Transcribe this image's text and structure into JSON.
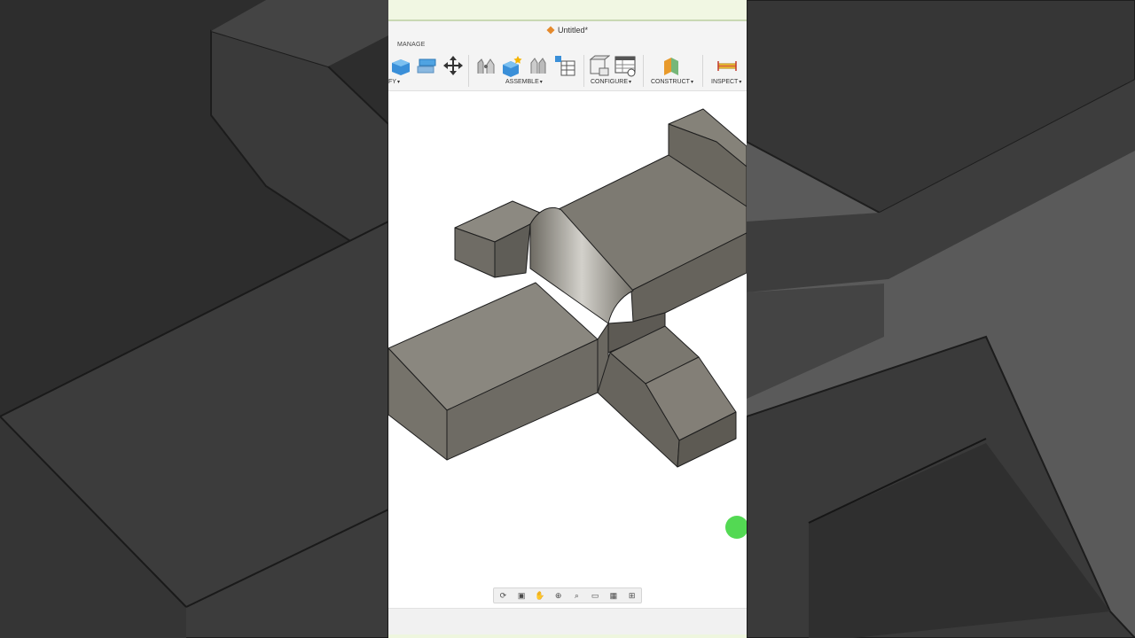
{
  "window": {
    "title": "Untitled*"
  },
  "toolbar": {
    "tab": "MANAGE",
    "groups": [
      {
        "label": "FY",
        "has_caret": true
      },
      {
        "label": "ASSEMBLE",
        "has_caret": true
      },
      {
        "label": "CONFIGURE",
        "has_caret": true
      },
      {
        "label": "CONSTRUCT",
        "has_caret": true
      },
      {
        "label": "INSPECT",
        "has_caret": true
      }
    ],
    "tools": [
      "shell-tool-icon",
      "combine-tool-icon",
      "move-tool-icon",
      "joint-icon",
      "new-component-icon",
      "as-built-joint-icon",
      "bill-of-materials-icon",
      "configure-cube-icon",
      "configure-table-icon",
      "construct-plane-icon",
      "measure-icon"
    ]
  },
  "viewport": {
    "model": "extruded-block-part",
    "body_color": "#7a776e"
  },
  "navigation": {
    "buttons": [
      "orbit-icon",
      "look-at-icon",
      "pan-icon",
      "zoom-icon",
      "fit-icon",
      "display-settings-icon",
      "grid-icon",
      "viewports-icon"
    ]
  },
  "colors": {
    "accent_green": "#35d235",
    "toolbar_bg": "#f4f4f4",
    "topbar_bg": "#f1f7e3"
  }
}
